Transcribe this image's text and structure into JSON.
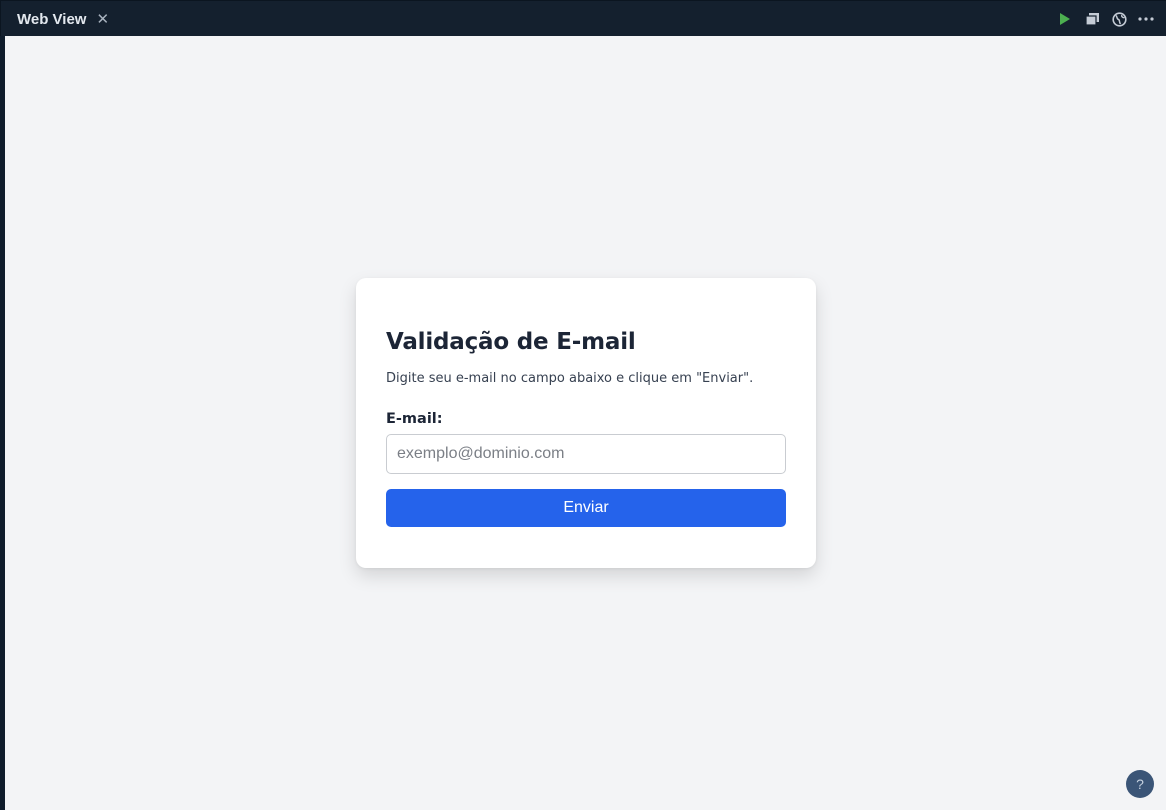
{
  "tab": {
    "title": "Web View",
    "close_glyph": "✕"
  },
  "toolbar_actions": [
    {
      "icon": "play-icon",
      "color": "#4caf50"
    },
    {
      "icon": "windows-icon",
      "color": "#c5ccd6"
    },
    {
      "icon": "globe-icon",
      "color": "#c5ccd6"
    },
    {
      "icon": "more-icon",
      "color": "#c5ccd6"
    }
  ],
  "form": {
    "title": "Validação de E-mail",
    "description": "Digite seu e-mail no campo abaixo e clique em \"Enviar\".",
    "email_label": "E-mail:",
    "email_value": "",
    "email_placeholder": "exemplo@dominio.com",
    "submit_label": "Enviar"
  },
  "help": {
    "label": "?"
  },
  "colors": {
    "accent": "#2563eb",
    "page_background": "#f3f4f6",
    "titlebar": "#14202e"
  }
}
